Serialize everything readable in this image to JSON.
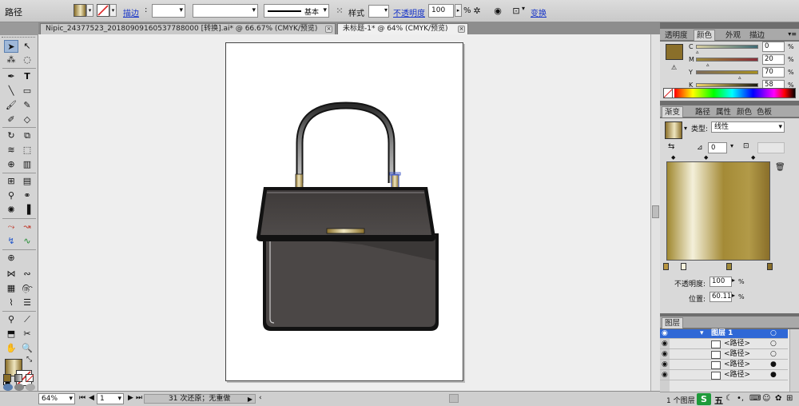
{
  "colors": {
    "gold_dark": "#8a6f2a",
    "gold_light": "#efe6c0",
    "bag_body": "#4b4746",
    "bag_outline": "#121212",
    "accent_blue": "#4d63c8",
    "selected_layer": "#2f68d6"
  },
  "control_bar": {
    "object_type": "路径",
    "stroke_link": "描边",
    "stroke_profile": "基本",
    "style_label": "样式",
    "opacity_link": "不透明度",
    "opacity_value": "100",
    "opacity_unit": "%",
    "transform_link": "变换"
  },
  "tabs": [
    {
      "label": "Nipic_24377523_20180909160537788000   [转换].ai* @ 66.67% (CMYK/预览)"
    },
    {
      "label": "未标题-1* @ 64% (CMYK/预览)"
    }
  ],
  "status": {
    "zoom": "64%",
    "page": "1",
    "undo_text": "31 次还原；无重做"
  },
  "color_panel": {
    "tabs": [
      "透明度",
      "颜色",
      "外观",
      "描边"
    ],
    "channels": [
      {
        "label": "C",
        "value": "0",
        "pct": "%"
      },
      {
        "label": "M",
        "value": "20",
        "pct": "%"
      },
      {
        "label": "Y",
        "value": "70",
        "pct": "%"
      },
      {
        "label": "K",
        "value": "58",
        "pct": "%"
      }
    ]
  },
  "gradient_panel": {
    "tabs": [
      "渐变",
      "路径",
      "属性",
      "颜色",
      "色板"
    ],
    "type_label": "类型:",
    "type_value": "线性",
    "angle_value": "0",
    "opacity_label": "不透明度:",
    "opacity_value": "100",
    "opacity_unit": "%",
    "position_label": "位置:",
    "position_value": "60.11",
    "position_unit": "%"
  },
  "layers_panel": {
    "tab": "图层",
    "rows": [
      {
        "name": "图层 1"
      },
      {
        "name": "<路径>"
      },
      {
        "name": "<路径>"
      },
      {
        "name": "<路径>"
      },
      {
        "name": "<路径>"
      }
    ],
    "footer": "1 个图层"
  },
  "ime": {
    "text": "五"
  }
}
